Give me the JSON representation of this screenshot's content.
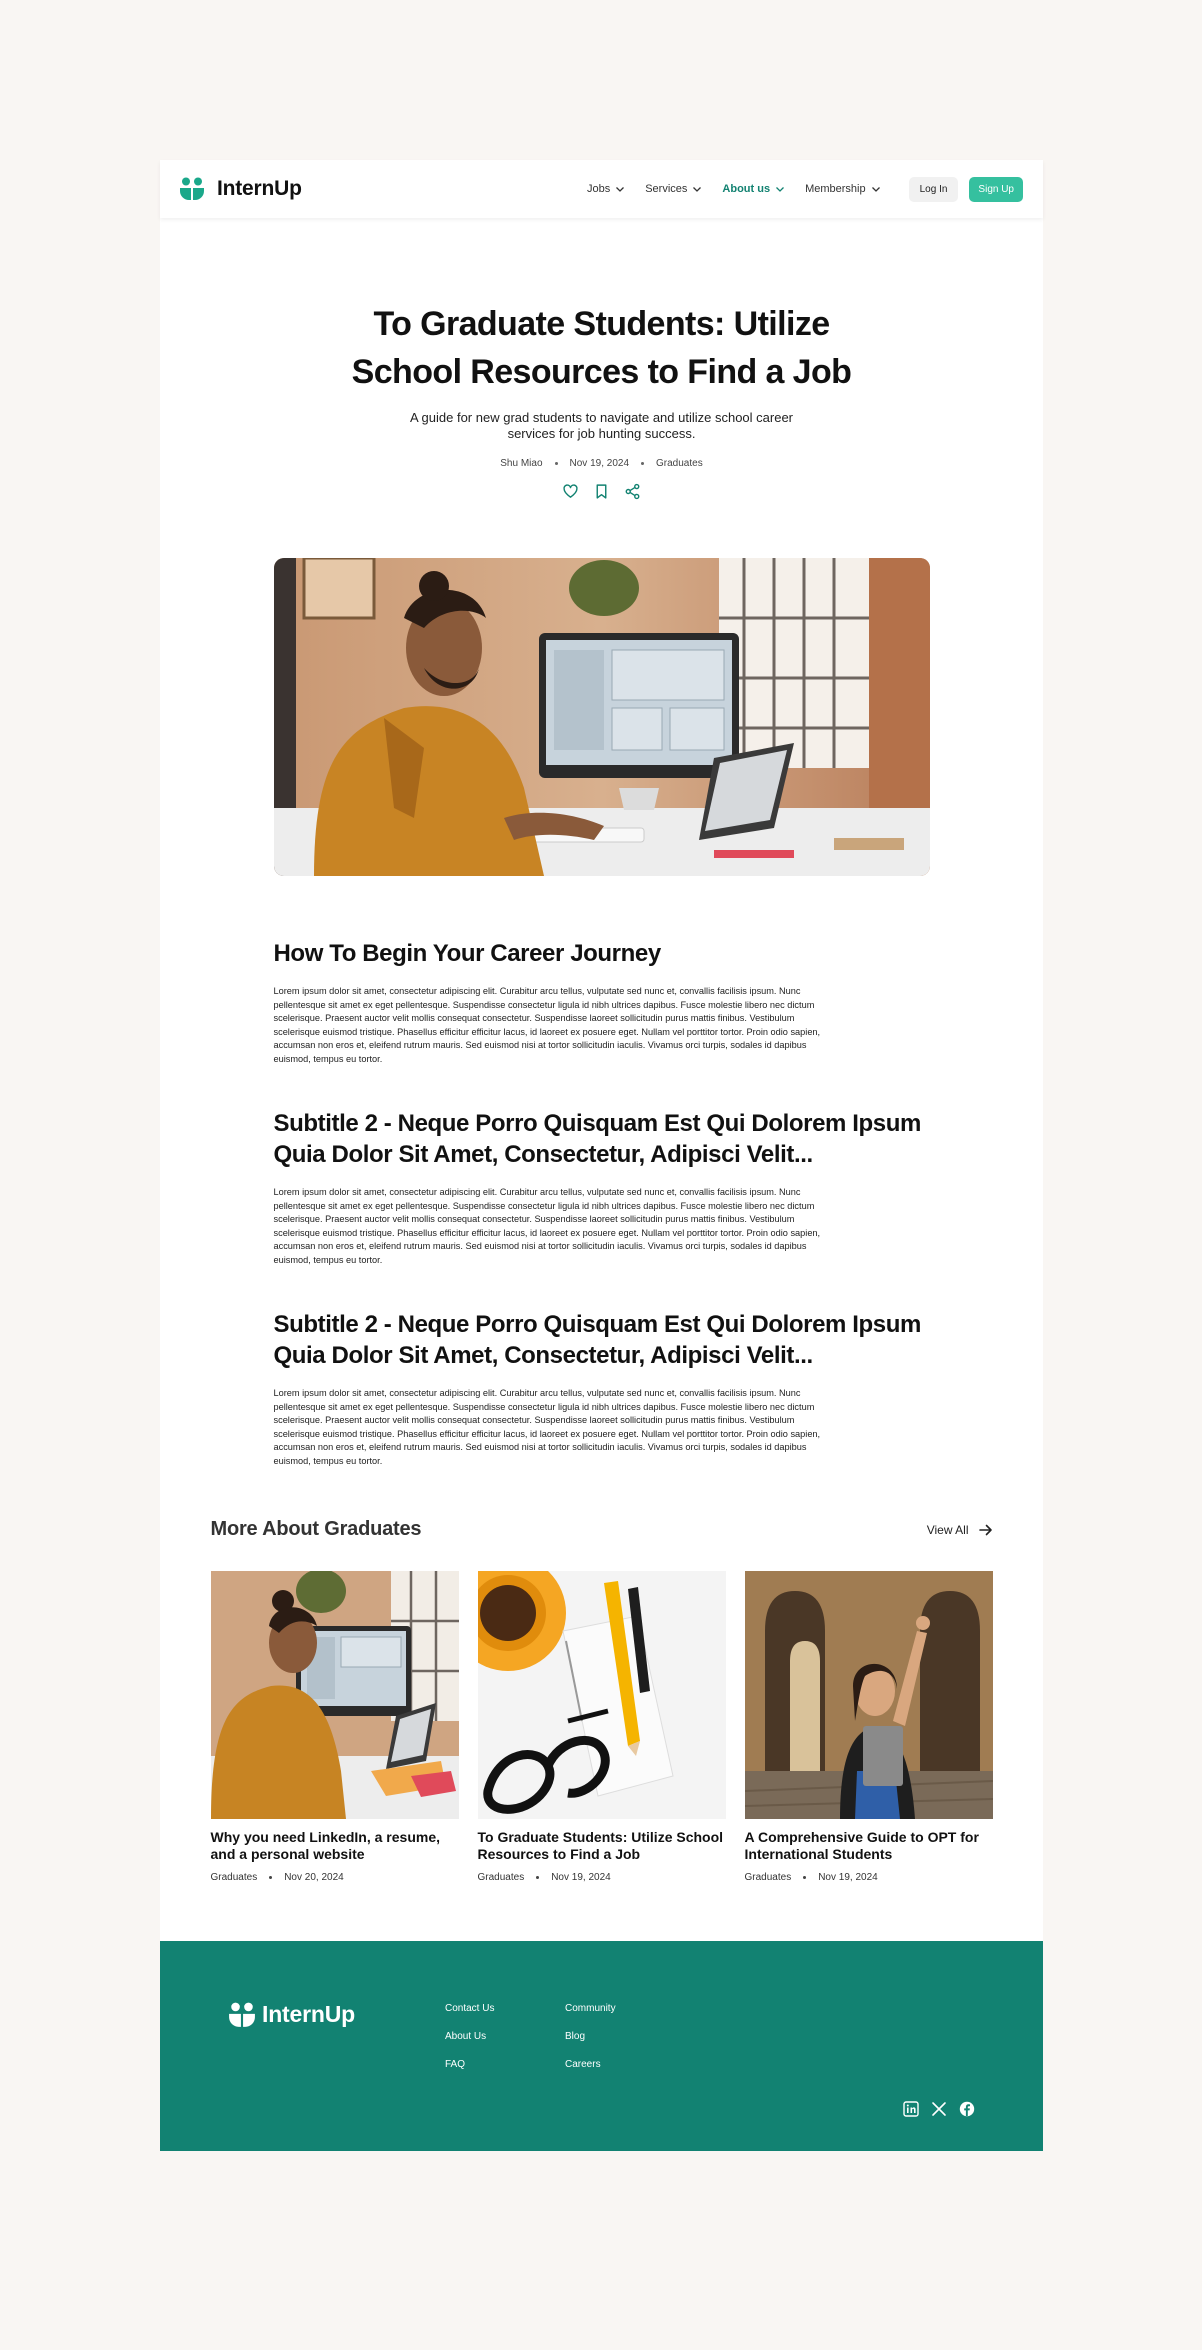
{
  "header": {
    "brand": "InternUp",
    "nav": [
      {
        "label": "Jobs"
      },
      {
        "label": "Services"
      },
      {
        "label": "About us"
      },
      {
        "label": "Membership"
      }
    ],
    "login": "Log In",
    "signup": "Sign Up",
    "accent": "#128271",
    "signup_color": "#35c09f"
  },
  "hero": {
    "title": "To Graduate Students: Utilize School Resources to Find a Job",
    "subtitle": "A guide for new grad students to navigate and utilize school career services for job hunting success.",
    "author": "Shu Miao",
    "date": "Nov 19, 2024",
    "category": "Graduates",
    "icons": [
      "heart-icon",
      "bookmark-icon",
      "share-icon"
    ]
  },
  "article": {
    "sections": [
      {
        "heading": "How To Begin Your Career Journey",
        "body": "Lorem ipsum dolor sit amet, consectetur adipiscing elit. Curabitur arcu tellus, vulputate sed nunc et, convallis facilisis ipsum. Nunc pellentesque sit amet ex eget pellentesque. Suspendisse consectetur ligula id nibh ultrices dapibus. Fusce molestie libero nec dictum scelerisque. Praesent auctor velit mollis consequat consectetur. Suspendisse laoreet sollicitudin purus mattis finibus. Vestibulum scelerisque euismod tristique. Phasellus efficitur efficitur lacus, id laoreet ex posuere eget. Nullam vel porttitor tortor. Proin odio sapien, accumsan non eros et, eleifend rutrum mauris. Sed euismod nisi at tortor sollicitudin iaculis. Vivamus orci turpis, sodales id dapibus euismod, tempus eu tortor."
      },
      {
        "heading": "Subtitle 2 - Neque Porro Quisquam Est Qui Dolorem Ipsum Quia Dolor Sit Amet, Consectetur, Adipisci Velit...",
        "body": "Lorem ipsum dolor sit amet, consectetur adipiscing elit. Curabitur arcu tellus, vulputate sed nunc et, convallis facilisis ipsum. Nunc pellentesque sit amet ex eget pellentesque. Suspendisse consectetur ligula id nibh ultrices dapibus. Fusce molestie libero nec dictum scelerisque. Praesent auctor velit mollis consequat consectetur. Suspendisse laoreet sollicitudin purus mattis finibus. Vestibulum scelerisque euismod tristique. Phasellus efficitur efficitur lacus, id laoreet ex posuere eget. Nullam vel porttitor tortor. Proin odio sapien, accumsan non eros et, eleifend rutrum mauris. Sed euismod nisi at tortor sollicitudin iaculis. Vivamus orci turpis, sodales id dapibus euismod, tempus eu tortor."
      },
      {
        "heading": "Subtitle 2 - Neque Porro Quisquam Est Qui Dolorem Ipsum Quia Dolor Sit Amet, Consectetur, Adipisci Velit...",
        "body": "Lorem ipsum dolor sit amet, consectetur adipiscing elit. Curabitur arcu tellus, vulputate sed nunc et, convallis facilisis ipsum. Nunc pellentesque sit amet ex eget pellentesque. Suspendisse consectetur ligula id nibh ultrices dapibus. Fusce molestie libero nec dictum scelerisque. Praesent auctor velit mollis consequat consectetur. Suspendisse laoreet sollicitudin purus mattis finibus. Vestibulum scelerisque euismod tristique. Phasellus efficitur efficitur lacus, id laoreet ex posuere eget. Nullam vel porttitor tortor. Proin odio sapien, accumsan non eros et, eleifend rutrum mauris. Sed euismod nisi at tortor sollicitudin iaculis. Vivamus orci turpis, sodales id dapibus euismod, tempus eu tortor."
      }
    ]
  },
  "more": {
    "heading": "More About Graduates",
    "view_all": "View All",
    "cards": [
      {
        "title": "Why you need LinkedIn, a resume, and a personal website",
        "category": "Graduates",
        "date": "Nov 20, 2024"
      },
      {
        "title": "To Graduate Students: Utilize School Resources to Find a Job",
        "category": "Graduates",
        "date": "Nov 19, 2024"
      },
      {
        "title": "A Comprehensive Guide to OPT for International Students",
        "category": "Graduates",
        "date": "Nov 19, 2024"
      }
    ]
  },
  "footer": {
    "brand": "InternUp",
    "col1": [
      "Contact Us",
      "About Us",
      "FAQ"
    ],
    "col2": [
      "Community",
      "Blog",
      "Careers"
    ],
    "socials": [
      "linkedin-icon",
      "x-icon",
      "facebook-icon"
    ],
    "background": "#128272"
  }
}
